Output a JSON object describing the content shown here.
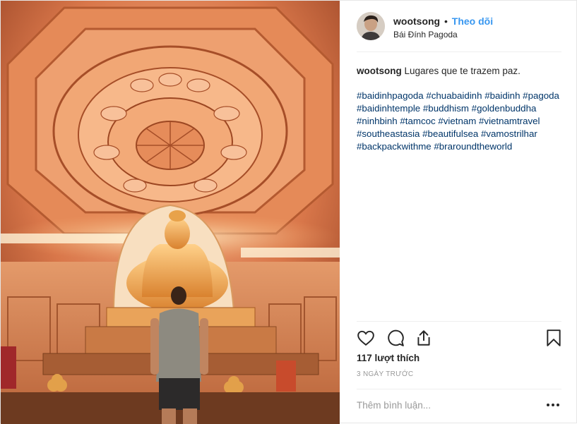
{
  "post": {
    "username": "wootsong",
    "separator": "•",
    "follow_label": "Theo dõi",
    "location": "Bái Đính Pagoda",
    "image_alt": "Golden Buddha statue inside Bai Dinh pagoda with a man standing in front",
    "caption_user": "wootsong",
    "caption_text": " Lugares que te trazem paz.",
    "hashtags": [
      "#baidinhpagoda",
      "#chuabaidinh",
      "#baidinh",
      "#pagoda",
      "#baidinhtemple",
      "#buddhism",
      "#goldenbuddha",
      "#ninhbinh",
      "#tamcoc",
      "#vietnam",
      "#vietnamtravel",
      "#southeastasia",
      "#beautifulsea",
      "#vamostrilhar",
      "#backpackwithme",
      "#braroundtheworld"
    ],
    "likes_text": "117 lượt thích",
    "time_text": "3 NGÀY TRƯỚC",
    "comment_placeholder": "Thêm bình luận...",
    "colors": {
      "follow": "#3897f0",
      "hashtag": "#003569",
      "muted": "#999999",
      "border": "#efefef"
    },
    "icons": [
      "heart-icon",
      "comment-icon",
      "share-icon",
      "bookmark-icon",
      "more-options-icon"
    ]
  }
}
